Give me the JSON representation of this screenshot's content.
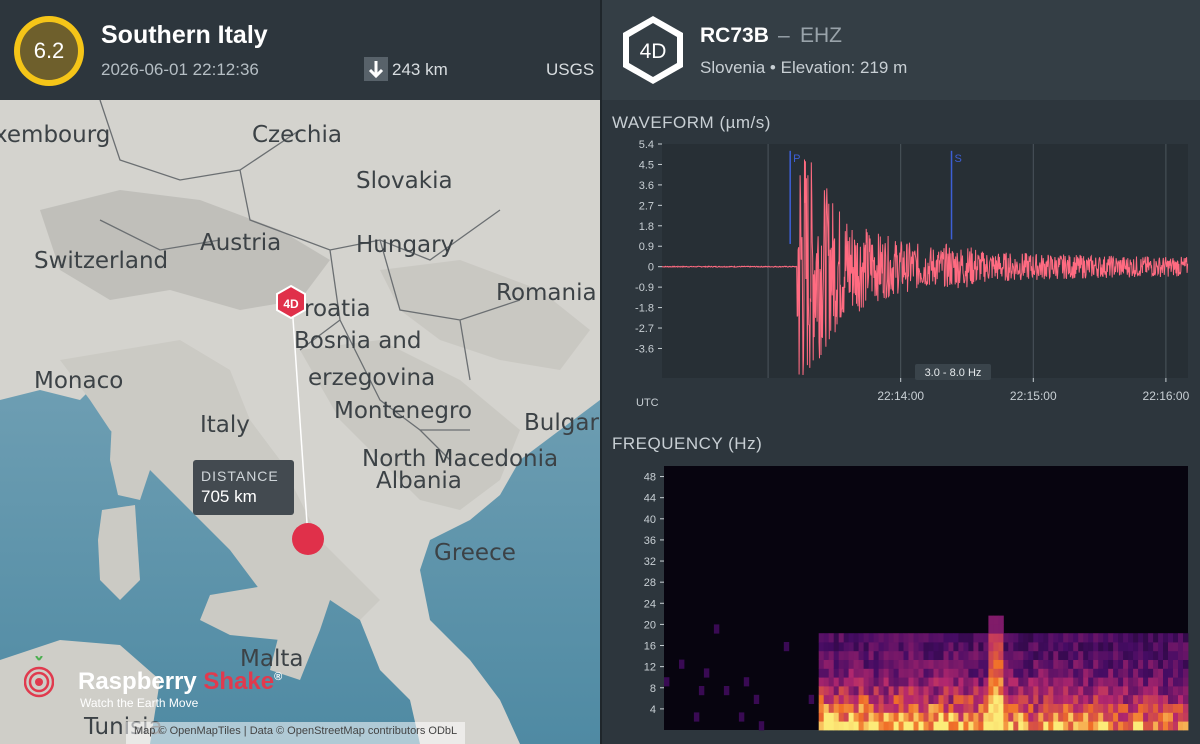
{
  "event": {
    "magnitude": "6.2",
    "title": "Southern Italy",
    "datetime": "2026-06-01 22:12:36",
    "depth": "243 km",
    "source": "USGS",
    "depth_icon": "arrow-down-icon"
  },
  "map": {
    "labels": [
      {
        "id": "luxembourg",
        "text": "xembourg"
      },
      {
        "id": "czechia",
        "text": "Czechia"
      },
      {
        "id": "slovakia",
        "text": "Slovakia"
      },
      {
        "id": "austria",
        "text": "Austria"
      },
      {
        "id": "switzerland",
        "text": "Switzerland"
      },
      {
        "id": "hungary",
        "text": "Hungary"
      },
      {
        "id": "romania",
        "text": "Romania"
      },
      {
        "id": "croatia",
        "text": "roatia"
      },
      {
        "id": "bosnia",
        "text": "Bosnia and"
      },
      {
        "id": "herzegovina",
        "text": "erzegovina"
      },
      {
        "id": "monaco",
        "text": "Monaco"
      },
      {
        "id": "italy",
        "text": "Italy"
      },
      {
        "id": "montenegro",
        "text": "Montenegro"
      },
      {
        "id": "bulgaria",
        "text": "Bulgar"
      },
      {
        "id": "north_macedonia",
        "text": "North Macedonia"
      },
      {
        "id": "albania",
        "text": "Albania"
      },
      {
        "id": "greece",
        "text": "Greece"
      },
      {
        "id": "malta",
        "text": "Malta"
      },
      {
        "id": "tunisia",
        "text": "Tunisia"
      }
    ],
    "station_marker": "4D",
    "distance_label": "DISTANCE",
    "distance_value": "705 km",
    "attribution": "Map © OpenMapTiles | Data © OpenStreetMap contributors ODbL",
    "logo_word1": "Raspberry",
    "logo_word2": "Shake",
    "logo_reg": "®",
    "logo_tagline": "Watch the Earth Move",
    "colors": {
      "epicenter": "#e0304a",
      "marker": "#e0304a"
    }
  },
  "station": {
    "network": "4D",
    "code": "RC73B",
    "separator": "–",
    "channel": "EHZ",
    "location": "Slovenia • Elevation: 219 m"
  },
  "waveform": {
    "title": "WAVEFORM (µm/s)",
    "filter": "3.0 - 8.0 Hz",
    "utc_label": "UTC",
    "p_label": "P",
    "s_label": "S"
  },
  "frequency": {
    "title": "FREQUENCY (Hz)"
  },
  "chart_data": [
    {
      "type": "line",
      "title": "WAVEFORM (µm/s)",
      "xlabel": "UTC",
      "ylabel": "",
      "y_ticks": [
        "5.4",
        "4.5",
        "3.6",
        "2.7",
        "1.8",
        "0.9",
        "0",
        "-0.9",
        "-1.8",
        "-2.7",
        "-3.6"
      ],
      "ylim": [
        -4.9,
        5.4
      ],
      "x_ticks": [
        "22:14:00",
        "22:15:00",
        "22:16:00"
      ],
      "xlim_seconds_from_2213": [
        -48,
        190
      ],
      "grid": true,
      "series_color": "#ff6b81",
      "phase_markers": [
        {
          "label": "P",
          "t": 10
        },
        {
          "label": "S",
          "t": 83
        }
      ],
      "signal_onset_t": 13,
      "peak_amplitude": 5.2,
      "annotation": "3.0 - 8.0 Hz"
    },
    {
      "type": "heatmap",
      "title": "FREQUENCY (Hz)",
      "ylabel": "Hz",
      "y_ticks": [
        "48",
        "44",
        "40",
        "36",
        "32",
        "28",
        "24",
        "20",
        "16",
        "12",
        "8",
        "4"
      ],
      "ylim": [
        0,
        50
      ],
      "colormap": "inferno",
      "onset_fraction": 0.3
    }
  ]
}
